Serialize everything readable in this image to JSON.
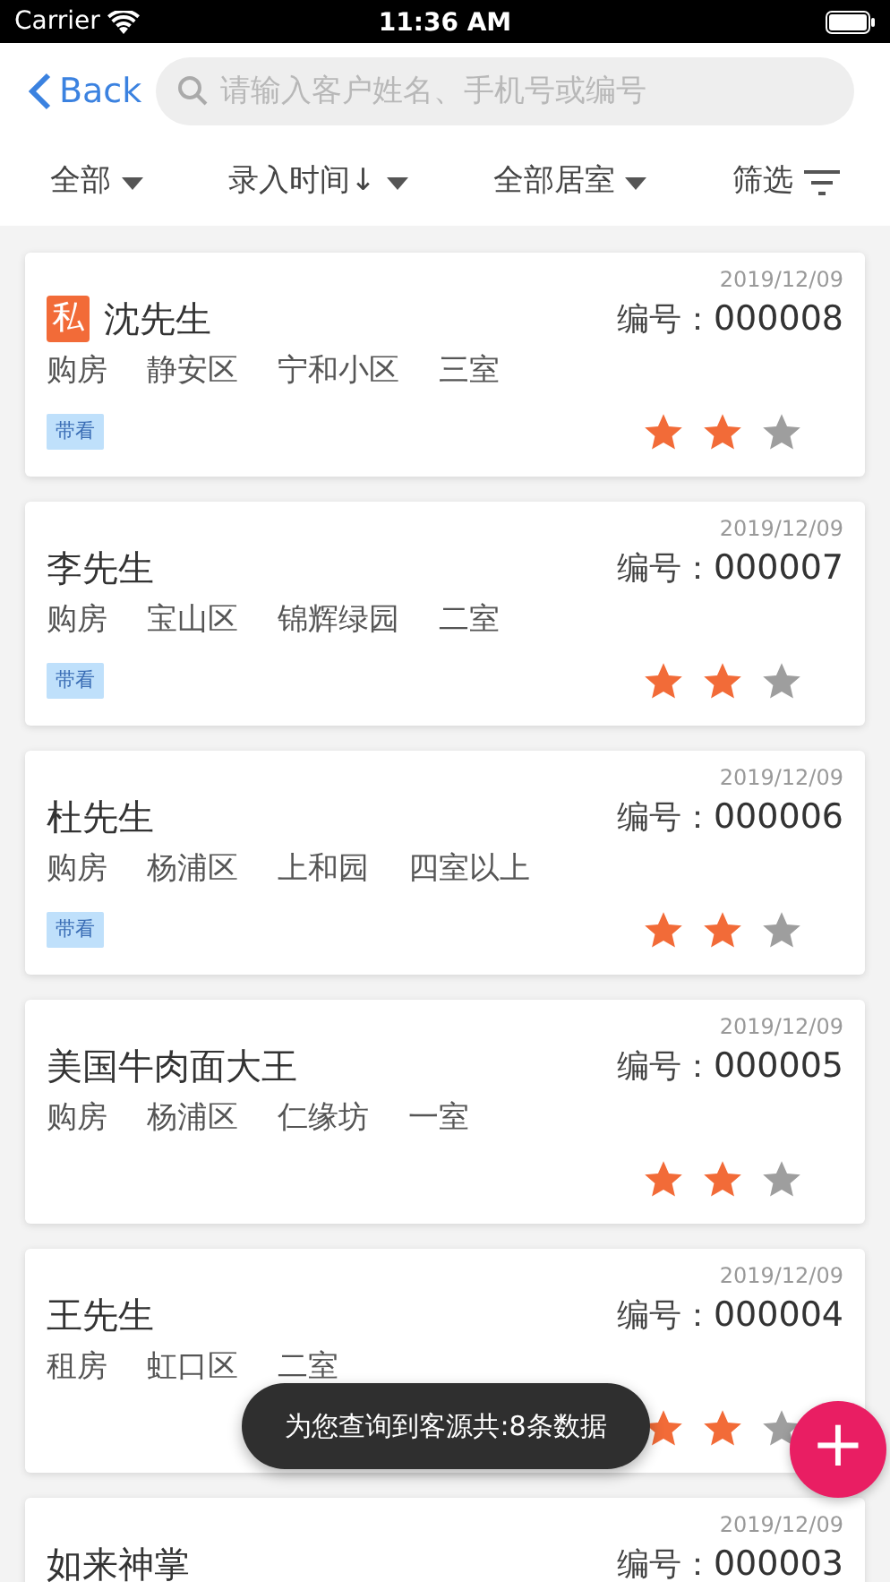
{
  "status_bar": {
    "carrier": "Carrier",
    "time": "11:36 AM"
  },
  "nav": {
    "back": "Back",
    "search": {
      "placeholder": "请输入客户姓名、手机号或编号"
    }
  },
  "filters": [
    {
      "label": "全部",
      "kind": "dropdown"
    },
    {
      "label": "录入时间↓",
      "kind": "dropdown"
    },
    {
      "label": "全部居室",
      "kind": "dropdown"
    },
    {
      "label": "筛选",
      "kind": "filter"
    }
  ],
  "customers": [
    {
      "private_badge": "私",
      "name": "沈先生",
      "date": "2019/12/09",
      "number_label": "编号：",
      "number": "000008",
      "details": [
        "购房",
        "静安区",
        "宁和小区",
        "三室"
      ],
      "tag": "带看",
      "stars": 2
    },
    {
      "name": "李先生",
      "date": "2019/12/09",
      "number_label": "编号：",
      "number": "000007",
      "details": [
        "购房",
        "宝山区",
        "锦辉绿园",
        "二室"
      ],
      "tag": "带看",
      "stars": 2
    },
    {
      "name": "杜先生",
      "date": "2019/12/09",
      "number_label": "编号：",
      "number": "000006",
      "details": [
        "购房",
        "杨浦区",
        "上和园",
        "四室以上"
      ],
      "tag": "带看",
      "stars": 2
    },
    {
      "name": "美国牛肉面大王",
      "date": "2019/12/09",
      "number_label": "编号：",
      "number": "000005",
      "details": [
        "购房",
        "杨浦区",
        "仁缘坊",
        "一室"
      ],
      "stars": 2
    },
    {
      "name": "王先生",
      "date": "2019/12/09",
      "number_label": "编号：",
      "number": "000004",
      "details": [
        "租房",
        "虹口区",
        "二室"
      ],
      "stars": 2
    },
    {
      "name": "如来神掌",
      "date": "2019/12/09",
      "number_label": "编号：",
      "number": "000003"
    }
  ],
  "toast": "为您查询到客源共:8条数据",
  "fab": "+"
}
